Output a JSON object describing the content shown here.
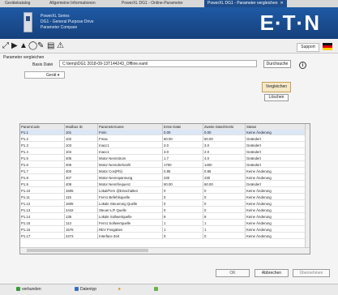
{
  "tabs": [
    {
      "label": "Gerätekatalog"
    },
    {
      "label": "Allgemeine Informationen"
    },
    {
      "label": "PowerXL DG1 - Online-Parameter"
    },
    {
      "label": "PowerXL DG1 - Parameter vergleichen",
      "close": "✕"
    }
  ],
  "header": {
    "line1": "PowerXL Series",
    "line2": "DG1 - General Purpose Drive",
    "line3": "Parameter Compare",
    "brand": "E·T·N"
  },
  "toolbar": {
    "icons": [
      "connect-icon",
      "play-icon",
      "warning-icon",
      "stop-icon",
      "signature-icon",
      "device-icon",
      "alert-icon"
    ],
    "support_label": "Support",
    "colors": {
      "header": "#1e5aa5",
      "active_tab": "#1f4e8c",
      "compare_button": "#f5e8c8"
    }
  },
  "compare": {
    "section_label": "Parameter vergleichen",
    "file_label": "Basis Datei",
    "file_value": "C:\\temp\\DG1 2018-09-13T144243_Offline.eaml",
    "browse_label": "Durchsuche",
    "info_symbol": "i",
    "filter_value": "Gerät",
    "compare_label": "Vergleichen",
    "delete_label": "Löschen"
  },
  "table": {
    "columns": [
      "ParamCode",
      "Modbus ID",
      "Parametername",
      "Erste Datei",
      "Zweite Datei/Gerät",
      "Status"
    ],
    "rows": [
      [
        "P1.1",
        "101",
        "Fmin",
        "0.00",
        "0.00",
        "Keine Änderung"
      ],
      [
        "P1.2",
        "102",
        "Fmax",
        "60.00",
        "50.00",
        "Geändert"
      ],
      [
        "P1.3",
        "103",
        "Inacc1",
        "3.0",
        "3.0",
        "Geändert"
      ],
      [
        "P1.4",
        "104",
        "Inacc1",
        "3.0",
        "2.0",
        "Geändert"
      ],
      [
        "P1.5",
        "405",
        "Motor Nennstrom",
        "1.7",
        "4.0",
        "Geändert"
      ],
      [
        "P1.6",
        "406",
        "Motor Nenndrehzahl",
        "1700",
        "1400",
        "Geändert"
      ],
      [
        "P1.7",
        "400",
        "Motor Cos(Phi)",
        "0.85",
        "0.85",
        "Keine Änderung"
      ],
      [
        "P1.8",
        "407",
        "Motor Nennspannung",
        "230",
        "230",
        "Keine Änderung"
      ],
      [
        "P1.9",
        "408",
        "Motor Nennfrequenz",
        "60.00",
        "60.00",
        "Geändert"
      ],
      [
        "P1.10",
        "1605",
        "Lokal/Fern @Einschalten",
        "0",
        "0",
        "Keine Änderung"
      ],
      [
        "P1.11",
        "115",
        "Fern1 Befehlsquelle",
        "0",
        "0",
        "Keine Änderung"
      ],
      [
        "P1.12",
        "1605",
        "Lokale Steuerung Quelle",
        "0",
        "0",
        "Keine Änderung"
      ],
      [
        "P1.13",
        "2442",
        "Steuer-L/F Quelle",
        "0",
        "0",
        "Keine Änderung"
      ],
      [
        "P1.14",
        "135",
        "Lokale Sollwertquelle",
        "8",
        "8",
        "Keine Änderung"
      ],
      [
        "P1.15",
        "113",
        "Fern1 Sollwertquelle",
        "1",
        "1",
        "Keine Änderung"
      ],
      [
        "P1.16",
        "1576",
        "REV Freigaben",
        "1",
        "1",
        "Keine Änderung"
      ],
      [
        "P1.17",
        "2473",
        "Interface Zeit",
        "0",
        "0",
        "Keine Änderung"
      ]
    ]
  },
  "buttons": {
    "ok": "OK",
    "cancel": "Abbrechen",
    "apply": "Übernehmen"
  },
  "statusbar": {
    "item1": "verbunden",
    "item2": "Datentyp",
    "item3": "★"
  }
}
